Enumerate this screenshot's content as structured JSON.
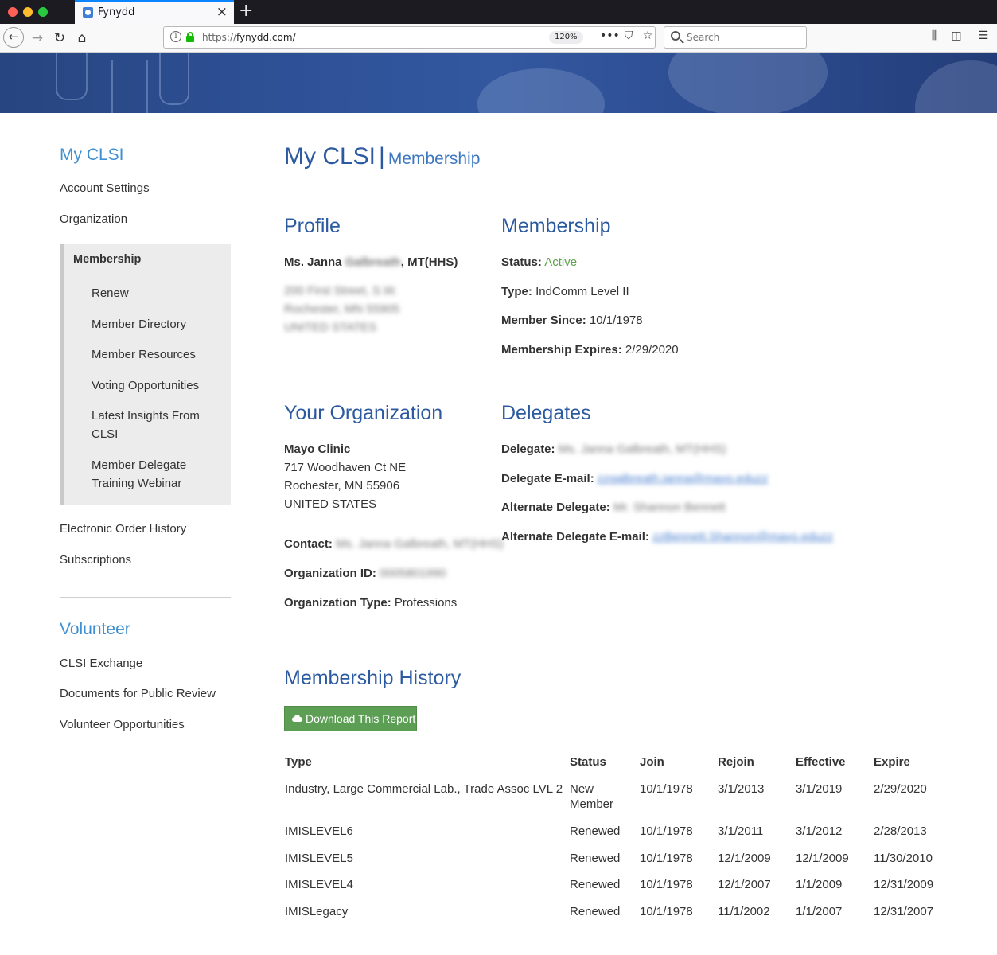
{
  "browser": {
    "tab_title": "Fynydd",
    "tab_close": "×",
    "new_tab": "+",
    "url_scheme": "https://",
    "url_host": "fynydd.com/",
    "zoom": "120%",
    "search_placeholder": "Search"
  },
  "sidebar": {
    "heading": "My CLSI",
    "top_items": [
      "Account Settings",
      "Organization"
    ],
    "membership_group": {
      "title": "Membership",
      "items": [
        "Renew",
        "Member Directory",
        "Member Resources",
        "Voting Opportunities",
        "Latest Insights From CLSI",
        "Member Delegate Training Webinar"
      ]
    },
    "lower_items": [
      "Electronic Order History",
      "Subscriptions"
    ],
    "volunteer_heading": "Volunteer",
    "volunteer_items": [
      "CLSI Exchange",
      "Documents for Public Review",
      "Volunteer Opportunities"
    ]
  },
  "page": {
    "title": "My CLSI",
    "separator": "|",
    "subtitle": "Membership"
  },
  "profile": {
    "heading": "Profile",
    "name_prefix": "Ms. Janna ",
    "name_blurred": "Galbreath",
    "name_suffix": ", MT(HHS)",
    "address_lines": [
      "200 First Street, S.W.",
      "Rochester, MN 55905",
      "UNITED STATES"
    ]
  },
  "membership": {
    "heading": "Membership",
    "status_label": "Status:",
    "status_value": "Active",
    "type_label": "Type:",
    "type_value": "IndComm Level II",
    "since_label": "Member Since:",
    "since_value": "10/1/1978",
    "expires_label": "Membership Expires:",
    "expires_value": "2/29/2020"
  },
  "organization": {
    "heading": "Your Organization",
    "name": "Mayo Clinic",
    "address_lines": [
      "717 Woodhaven Ct NE",
      "Rochester, MN 55906",
      "UNITED STATES"
    ],
    "contact_label": "Contact:",
    "contact_value": "Ms. Janna Galbreath, MT(HHS)",
    "id_label": "Organization ID:",
    "id_value": "0005801990",
    "type_label": "Organization Type:",
    "type_value": "Professions"
  },
  "delegates": {
    "heading": "Delegates",
    "delegate_label": "Delegate:",
    "delegate_value": "Ms. Janna Galbreath, MT(HHS)",
    "email_label": "Delegate E-mail:",
    "email_value": "zzgalbreath.janna@mayo.eduzz",
    "alt_label": "Alternate Delegate:",
    "alt_value": "Mr. Shannon Bennett",
    "alt_email_label": "Alternate Delegate E-mail:",
    "alt_email_value": "zzBennett.Shannon@mayo.eduzz"
  },
  "history": {
    "heading": "Membership History",
    "download_label": "Download This Report",
    "columns": [
      "Type",
      "Status",
      "Join",
      "Rejoin",
      "Effective",
      "Expire"
    ],
    "rows": [
      [
        "Industry, Large Commercial Lab., Trade Assoc LVL 2",
        "New Member",
        "10/1/1978",
        "3/1/2013",
        "3/1/2019",
        "2/29/2020"
      ],
      [
        "IMISLEVEL6",
        "Renewed",
        "10/1/1978",
        "3/1/2011",
        "3/1/2012",
        "2/28/2013"
      ],
      [
        "IMISLEVEL5",
        "Renewed",
        "10/1/1978",
        "12/1/2009",
        "12/1/2009",
        "11/30/2010"
      ],
      [
        "IMISLEVEL4",
        "Renewed",
        "10/1/1978",
        "12/1/2007",
        "1/1/2009",
        "12/31/2009"
      ],
      [
        "IMISLegacy",
        "Renewed",
        "10/1/1978",
        "11/1/2002",
        "1/1/2007",
        "12/31/2007"
      ]
    ]
  },
  "colors": {
    "heading_blue": "#2c5aa0",
    "sidebar_blue": "#3f8fd2",
    "active_green": "#5ba44b",
    "button_green": "#5c9f54"
  }
}
